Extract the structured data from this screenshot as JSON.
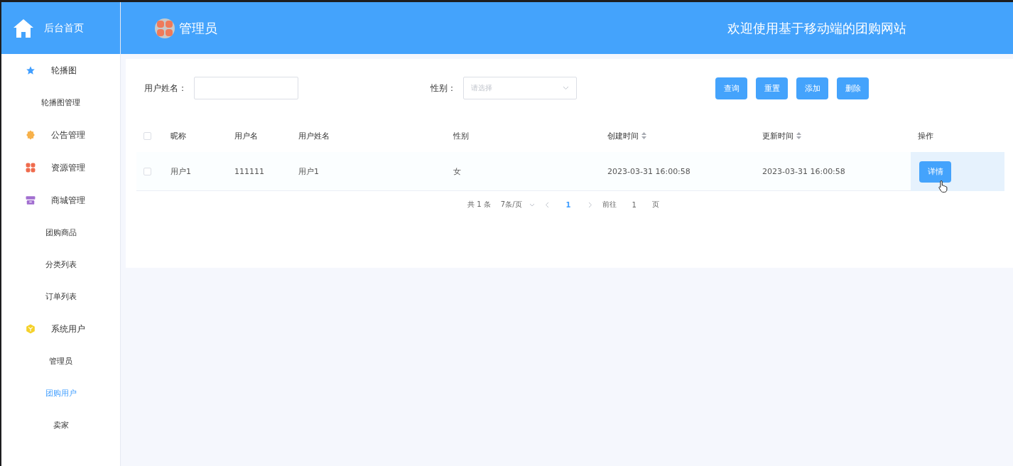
{
  "header": {
    "home_label": "后台首页",
    "user": "管理员",
    "welcome": "欢迎使用基于移动端的团购网站"
  },
  "sidebar": {
    "items": [
      {
        "label": "轮播图",
        "selected": false,
        "children": [
          {
            "label": "轮播图管理",
            "selected": false
          }
        ]
      },
      {
        "label": "公告管理",
        "selected": false
      },
      {
        "label": "资源管理",
        "selected": false
      },
      {
        "label": "商城管理",
        "selected": false,
        "children": [
          {
            "label": "团购商品",
            "selected": false
          },
          {
            "label": "分类列表",
            "selected": false
          },
          {
            "label": "订单列表",
            "selected": false
          }
        ]
      },
      {
        "label": "系统用户",
        "selected": false,
        "children": [
          {
            "label": "管理员",
            "selected": false
          },
          {
            "label": "团购用户",
            "selected": true
          },
          {
            "label": "卖家",
            "selected": false
          }
        ]
      }
    ]
  },
  "filters": [
    {
      "label": "用户姓名：",
      "kind": "input"
    },
    {
      "label": "性别：",
      "kind": "select",
      "placeholder": "请选择"
    }
  ],
  "buttons": [
    "查询",
    "重置",
    "添加",
    "删除"
  ],
  "table": {
    "select_all_checked": false,
    "columns": [
      {
        "label": "昵称",
        "sortable": false
      },
      {
        "label": "用户名",
        "sortable": false
      },
      {
        "label": "用户姓名",
        "sortable": false
      },
      {
        "label": "性别",
        "sortable": false
      },
      {
        "label": "创建时间",
        "sortable": true
      },
      {
        "label": "更新时间",
        "sortable": true
      },
      {
        "label": "操作",
        "sortable": false
      }
    ],
    "rows": [
      {
        "checked": false,
        "cells": [
          "用户1",
          "111111",
          "用户1",
          "女",
          "2023-03-31 16:00:58",
          "2023-03-31 16:00:58"
        ],
        "action": "详情"
      }
    ]
  },
  "pagination": {
    "total": "共 1 条",
    "page_size": "7条/页",
    "pages": [
      {
        "label": "1",
        "selected": true
      }
    ],
    "goto_label": "前往",
    "goto_value": "1",
    "goto_suffix": "页"
  }
}
